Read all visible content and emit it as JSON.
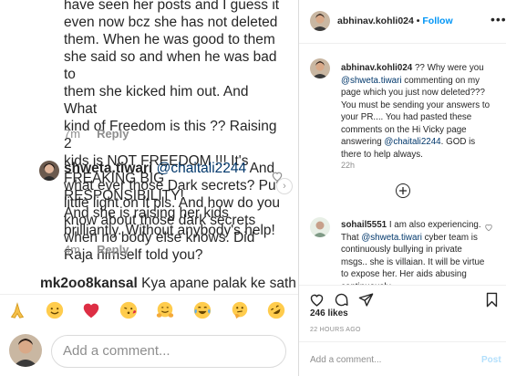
{
  "left": {
    "comment1": {
      "text_lines": [
        "have seen her posts and I guess it",
        "even now bcz she has not deleted",
        "them. When he was good to them",
        "she said so and when he was bad to",
        "them she kicked him out. And What",
        "kind of Freedom is this ?? Raising 2",
        "kids is NOT FREEDOM !!! It's",
        "FREAKING BIG RESPONSIBILITY!",
        "And she is raising her kids",
        "brilliantly. Without anybody's help!"
      ],
      "time": "7m",
      "reply": "Reply"
    },
    "comment2": {
      "username": "shweta.tiwari",
      "mention": "@chaitali2244",
      "text": " And what ever those Dark secrets? Put little light on it pls. And how do you know about those dark secrets when no body else knows. Did Raja himself told you?",
      "time": "4m",
      "reply": "Reply"
    },
    "comment3": {
      "username": "mk2oo8kansal",
      "text": " Kya apane palak ke sath"
    },
    "emojis": [
      "folded-hands",
      "smiling-face",
      "red-heart",
      "face-blowing-kiss",
      "hugging-face",
      "tears-of-joy",
      "thinking-face",
      "rolling-laughing"
    ],
    "input_placeholder": "Add a comment..."
  },
  "right": {
    "header": {
      "username": "abhinav.kohli024",
      "separator": "•",
      "follow": "Follow"
    },
    "caption": {
      "username": "abhinav.kohli024",
      "text_a": " ?? Why were you ",
      "mention1": "@shweta.tiwari",
      "text_b": " commenting on my page which you just now deleted??? You must be sending your answers to your PR.... You had pasted these comments on the Hi Vicky page answering ",
      "mention2": "@chaitali2244",
      "text_c": ". GOD is there to help always.",
      "time": "22h"
    },
    "reply_comment": {
      "username": "sohail5551",
      "text_a": " I am also experiencing. That ",
      "mention": "@shweta.tiwari",
      "text_b": " cyber team is continuously bullying in private msgs.. she is villaian. It will be virtue to expose her. Her aids abusing continuously"
    },
    "likes": "246 likes",
    "posted_ago": "22 HOURS AGO",
    "add_comment_placeholder": "Add a comment...",
    "post_label": "Post"
  }
}
